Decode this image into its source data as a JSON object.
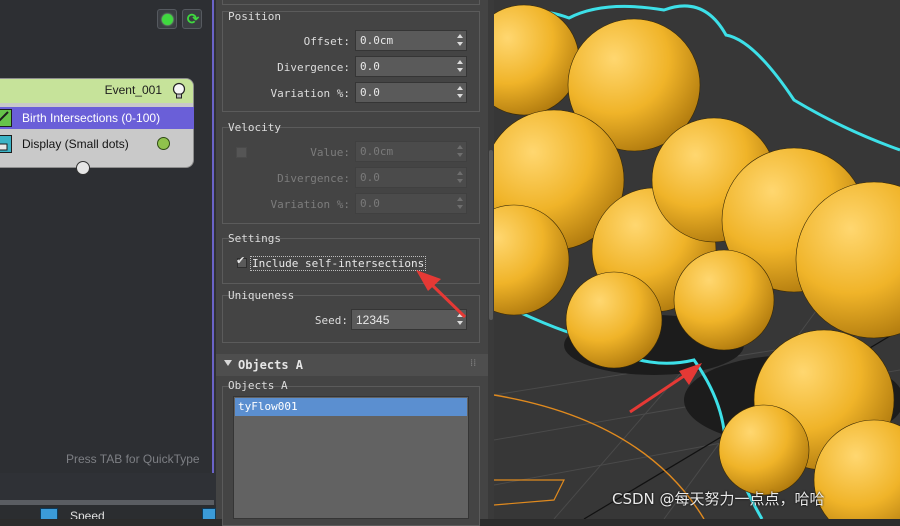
{
  "flow_editor": {
    "event_name": "Event_001",
    "operators": [
      {
        "label": "Birth Intersections (0-100)",
        "icon": "birth-operator-icon"
      },
      {
        "label": "Display (Small dots)",
        "icon": "display-operator-icon"
      }
    ],
    "hint": "Press TAB for QuickType",
    "bottom_event_label": "Speed",
    "colors": {
      "event_header": "#c6e39a",
      "selected_operator": "#6a5fd8",
      "border_accent": "#6b63c8"
    }
  },
  "properties": {
    "position": {
      "title": "Position",
      "offset_label": "Offset:",
      "offset_value": "0.0cm",
      "divergence_label": "Divergence:",
      "divergence_value": "0.0",
      "variation_label": "Variation %:",
      "variation_value": "0.0"
    },
    "velocity": {
      "title": "Velocity",
      "value_label": "Value:",
      "value_value": "0.0cm",
      "divergence_label": "Divergence:",
      "divergence_value": "0.0",
      "variation_label": "Variation %:",
      "variation_value": "0.0",
      "enabled": false
    },
    "settings": {
      "title": "Settings",
      "include_label": "Include self-intersections",
      "include_checked": true
    },
    "uniqueness": {
      "title": "Uniqueness",
      "seed_label": "Seed:",
      "seed_value": "12345"
    },
    "objects": {
      "rollout_title": "Objects A",
      "group_title": "Objects A",
      "items": [
        "tyFlow001"
      ]
    }
  },
  "viewport": {
    "watermark": "CSDN @每天努力一点点，哈哈",
    "colors": {
      "spheres": "#f0b429",
      "outline": "#3de0e8",
      "annotation_arrow": "#e53935"
    }
  }
}
